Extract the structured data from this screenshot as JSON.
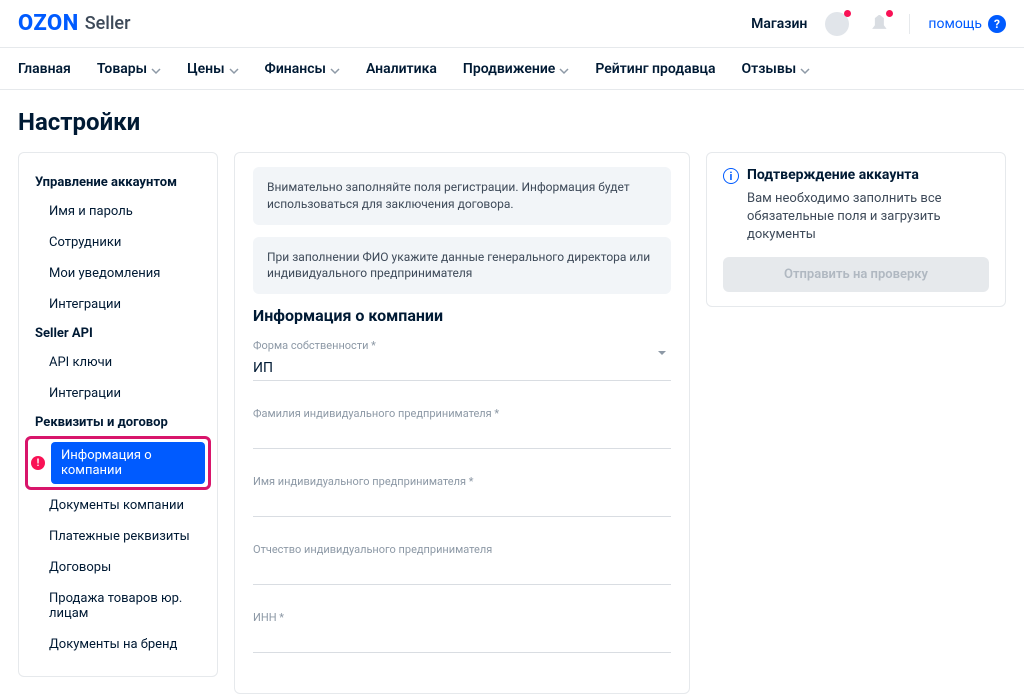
{
  "header": {
    "logo_main": "OZON",
    "logo_sub": "Seller",
    "shop_label": "Магазин",
    "help_label": "помощь"
  },
  "nav": [
    {
      "label": "Главная",
      "caret": false
    },
    {
      "label": "Товары",
      "caret": true
    },
    {
      "label": "Цены",
      "caret": true
    },
    {
      "label": "Финансы",
      "caret": true
    },
    {
      "label": "Аналитика",
      "caret": false
    },
    {
      "label": "Продвижение",
      "caret": true
    },
    {
      "label": "Рейтинг продавца",
      "caret": false
    },
    {
      "label": "Отзывы",
      "caret": true
    }
  ],
  "page_title": "Настройки",
  "sidebar": {
    "sections": [
      {
        "title": "Управление аккаунтом",
        "items": [
          "Имя и пароль",
          "Сотрудники",
          "Мои уведомления",
          "Интеграции"
        ]
      },
      {
        "title": "Seller API",
        "items": [
          "API ключи",
          "Интеграции"
        ]
      },
      {
        "title": "Реквизиты и договор",
        "items": [
          "Информация о компании",
          "Документы компании",
          "Платежные реквизиты",
          "Договоры",
          "Продажа товаров юр. лицам",
          "Документы на бренд"
        ]
      }
    ],
    "active": "Информация о компании"
  },
  "main": {
    "notice1": "Внимательно заполняйте поля регистрации. Информация будет использоваться для заключения договора.",
    "notice2": "При заполнении ФИО укажите данные генерального директора или индивидуального предпринимателя",
    "section_title": "Информация о компании",
    "fields": {
      "ownership": {
        "label": "Форма собственности *",
        "value": "ИП"
      },
      "lastname": {
        "label": "Фамилия индивидуального предпринимателя *"
      },
      "firstname": {
        "label": "Имя индивидуального предпринимателя *"
      },
      "middlename": {
        "label": "Отчество индивидуального предпринимателя"
      },
      "inn": {
        "label": "ИНН *"
      }
    }
  },
  "aside": {
    "title": "Подтверждение аккаунта",
    "text": "Вам необходимо заполнить все обязательные поля и загрузить документы",
    "button": "Отправить на проверку"
  }
}
